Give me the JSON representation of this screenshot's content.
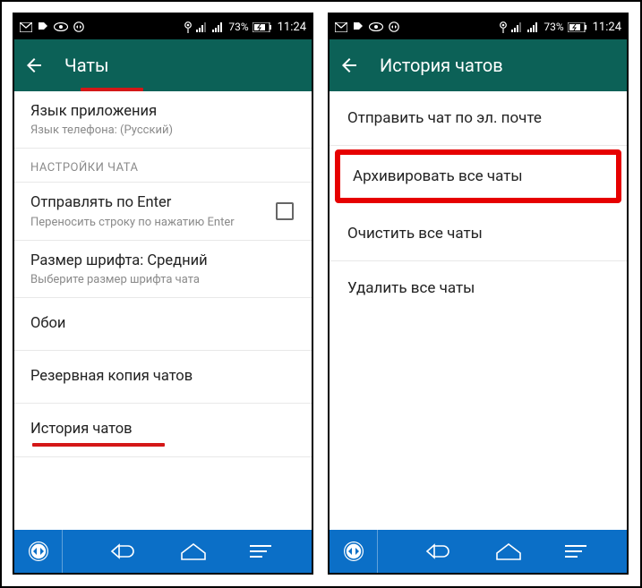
{
  "status": {
    "battery": "73%",
    "time": "11:24"
  },
  "left": {
    "title": "Чаты",
    "lang_label": "Язык приложения",
    "lang_value": "Язык телефона: (Русский)",
    "section": "НАСТРОЙКИ ЧАТА",
    "enter_label": "Отправлять по Enter",
    "enter_desc": "Переносить строку по нажатию Enter",
    "font_label": "Размер шрифта: Средний",
    "font_desc": "Выберите размер шрифта чата",
    "wallpaper": "Обои",
    "backup": "Резервная копия чатов",
    "history": "История чатов"
  },
  "right": {
    "title": "История чатов",
    "email": "Отправить чат по эл. почте",
    "archive": "Архивировать все чаты",
    "clear": "Очистить все чаты",
    "delete": "Удалить все чаты"
  }
}
